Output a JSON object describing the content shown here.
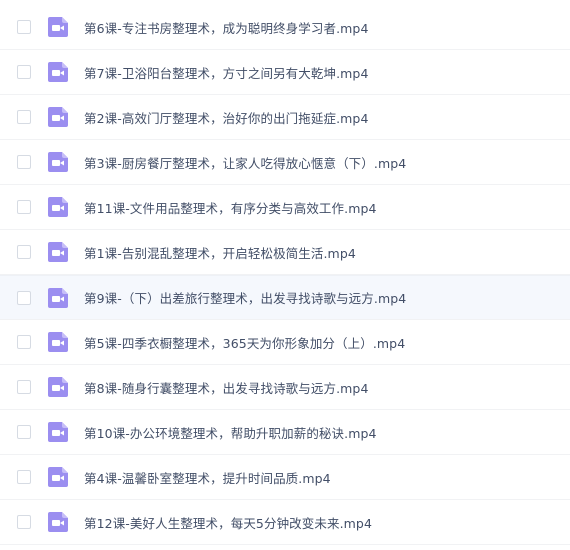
{
  "colors": {
    "icon_bg": "#9b8ef0",
    "icon_fold": "#c6bef8",
    "icon_glyph": "#ffffff",
    "text": "#424e67",
    "hover_row": "#f5f8fd"
  },
  "files": [
    {
      "name": "第6课-专注书房整理术，成为聪明终身学习者.mp4",
      "icon": "video-file-icon"
    },
    {
      "name": "第7课-卫浴阳台整理术，方寸之间另有大乾坤.mp4",
      "icon": "video-file-icon"
    },
    {
      "name": "第2课-高效门厅整理术，治好你的出门拖延症.mp4",
      "icon": "video-file-icon"
    },
    {
      "name": "第3课-厨房餐厅整理术，让家人吃得放心惬意（下）.mp4",
      "icon": "video-file-icon"
    },
    {
      "name": "第11课-文件用品整理术，有序分类与高效工作.mp4",
      "icon": "video-file-icon"
    },
    {
      "name": "第1课-告别混乱整理术，开启轻松极简生活.mp4",
      "icon": "video-file-icon"
    },
    {
      "name": "第9课-（下）出差旅行整理术，出发寻找诗歌与远方.mp4",
      "icon": "video-file-icon",
      "hovered": true
    },
    {
      "name": "第5课-四季衣橱整理术，365天为你形象加分（上）.mp4",
      "icon": "video-file-icon"
    },
    {
      "name": "第8课-随身行囊整理术，出发寻找诗歌与远方.mp4",
      "icon": "video-file-icon"
    },
    {
      "name": "第10课-办公环境整理术，帮助升职加薪的秘诀.mp4",
      "icon": "video-file-icon"
    },
    {
      "name": "第4课-温馨卧室整理术，提升时间品质.mp4",
      "icon": "video-file-icon"
    },
    {
      "name": "第12课-美好人生整理术，每天5分钟改变未来.mp4",
      "icon": "video-file-icon"
    }
  ]
}
